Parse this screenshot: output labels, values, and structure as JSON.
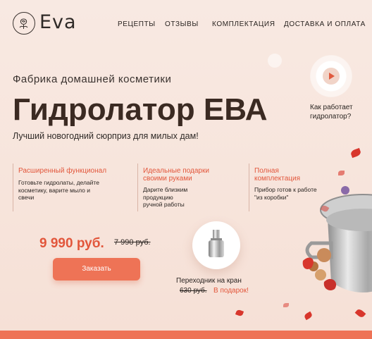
{
  "header": {
    "logo_text": "Eva",
    "nav": [
      "РЕЦЕПТЫ",
      "ОТЗЫВЫ",
      "КОМПЛЕКТАЦИЯ",
      "ДОСТАВКА И ОПЛАТА"
    ]
  },
  "hero": {
    "tagline": "Фабрика домашней косметики",
    "title": "Гидролатор ЕВА",
    "subtitle": "Лучший новогодний сюрприз для милых дам!",
    "video_label_line1": "Как работает",
    "video_label_line2": "гидролатор?"
  },
  "features": [
    {
      "title_line1": "Расширенный функционал",
      "title_line2": "",
      "text": [
        "Готовьте гидролаты, делайте",
        "косметику, варите мыло и",
        "свечи"
      ]
    },
    {
      "title_line1": "Идеальные подарки",
      "title_line2": "своими руками",
      "text": [
        "Дарите близким",
        "продукцию",
        "ручной работы"
      ]
    },
    {
      "title_line1": "Полная",
      "title_line2": "комплектация",
      "text": [
        "Прибор готов к работе",
        "\"из коробки\""
      ]
    }
  ],
  "pricing": {
    "price": "9 990 руб.",
    "old_price": "7 990 руб.",
    "order_button": "Заказать"
  },
  "adapter": {
    "label": "Переходник на кран",
    "old_price": "630 руб.",
    "gift": "В подарок!"
  },
  "colors": {
    "accent": "#e2563b",
    "button": "#ee7356",
    "background": "#f8e9e2"
  },
  "icons": [
    "logo-rose-icon",
    "play-icon"
  ]
}
